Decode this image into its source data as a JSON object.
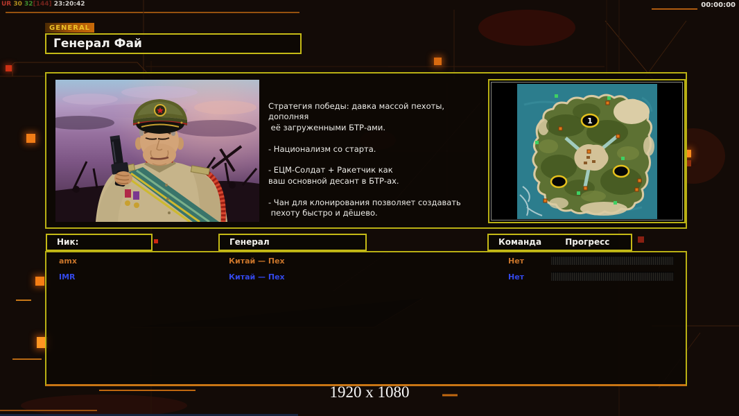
{
  "debug_overlay": {
    "parts": [
      {
        "text": "UR ",
        "color": "#b5372b"
      },
      {
        "text": "30 ",
        "color": "#b08e1f"
      },
      {
        "text": "32",
        "color": "#3f8f2f"
      },
      {
        "text": "[144] ",
        "color": "#70221c"
      },
      {
        "text": "23:20:42",
        "color": "#d2cfcb"
      }
    ]
  },
  "clock": "00:00:00",
  "tab": {
    "label": "GENERAL"
  },
  "title": "Генерал Фай",
  "strategy_text": "Стратегия победы: давка массой пехоты, дополняя\n её загруженными БТР-ами.\n\n- Национализм со старта.\n\n- ЕЦМ-Солдат + Ракетчик как\nваш основной десант в БТР-ах.\n\n- Чан для клонирования позволяет создавать\n пехоту быстро и дёшево.",
  "map": {
    "start_marker_label": "1"
  },
  "table": {
    "headers": {
      "nick": "Ник:",
      "general": "Генерал",
      "team": "Команда",
      "progress": "Прогресс"
    }
  },
  "players": [
    {
      "nick": "amx",
      "general": "Китай — Пех",
      "team": "Нет",
      "color": "#c8742a"
    },
    {
      "nick": "IMR",
      "general": "Китай — Пех",
      "team": "Нет",
      "color": "#3348e8"
    }
  ],
  "footer": {
    "resolution": "1920 x 1080"
  },
  "colors": {
    "panel_border_yellow": "#b9b014",
    "bottom_border_orange": "#c87514",
    "bright_node_orange": "#ff8c1c",
    "background": "#130b07"
  }
}
